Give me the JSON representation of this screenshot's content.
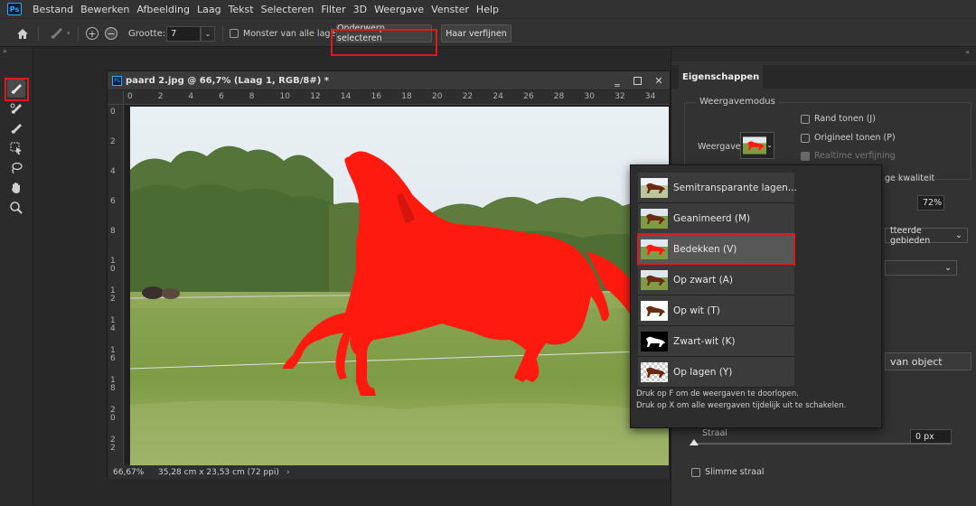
{
  "app": {
    "logo": "Ps"
  },
  "menu": [
    "Bestand",
    "Bewerken",
    "Afbeelding",
    "Laag",
    "Tekst",
    "Selecteren",
    "Filter",
    "3D",
    "Weergave",
    "Venster",
    "Help"
  ],
  "options_bar": {
    "size_label": "Grootte:",
    "size_value": "7",
    "sample_all_layers_label": "Monster van alle lagen",
    "select_subject_label": "Onderwerp selecteren",
    "refine_hair_label": "Haar verfijnen"
  },
  "document": {
    "title": "paard 2.jpg @ 66,7% (Laag 1, RGB/8#) *",
    "ruler_h_ticks": [
      "0",
      "2",
      "4",
      "6",
      "8",
      "10",
      "12",
      "14",
      "16",
      "18",
      "20",
      "22",
      "24",
      "26",
      "28",
      "30",
      "32",
      "34"
    ],
    "ruler_v_ticks": [
      "0",
      "2",
      "4",
      "6",
      "8",
      "1\n0",
      "1\n2",
      "1\n4",
      "1\n6",
      "1\n8",
      "2\n0",
      "2\n2"
    ],
    "zoom": "66,67%",
    "dimensions": "35,28 cm x 23,53 cm (72 ppi)"
  },
  "properties": {
    "tab": "Eigenschappen",
    "view_mode_group": "Weergavemodus",
    "view_label": "Weergave",
    "show_edge": "Rand tonen (J)",
    "show_original": "Origineel tonen (P)",
    "realtime_refine": "Realtime verfijning",
    "high_quality_partial": "ge kwaliteit",
    "opacity_value": "72%",
    "overlay_option_partial": "tteerde gebieden",
    "object_partial": "van object",
    "radius_label": "Straal",
    "radius_value": "0 px",
    "radius_fraction": 0,
    "smart_radius": "Slimme straal"
  },
  "view_popup": {
    "items": [
      {
        "label": "Semitransparante lagen...",
        "thumb": "semi"
      },
      {
        "label": "Geanimeerd (M)",
        "thumb": "normal"
      },
      {
        "label": "Bedekken (V)",
        "thumb": "red"
      },
      {
        "label": "Op zwart (A)",
        "thumb": "normal"
      },
      {
        "label": "Op wit (T)",
        "thumb": "white"
      },
      {
        "label": "Zwart-wit (K)",
        "thumb": "bw"
      },
      {
        "label": "Op lagen (Y)",
        "thumb": "checker"
      }
    ],
    "selected_index": 2,
    "footer_line1": "Druk op F om de weergaven te doorlopen.",
    "footer_line2": "Druk op X om alle weergaven tijdelijk uit te schakelen."
  },
  "colors": {
    "highlight": "#e0191d",
    "overlay_red": "#ff1a10"
  }
}
